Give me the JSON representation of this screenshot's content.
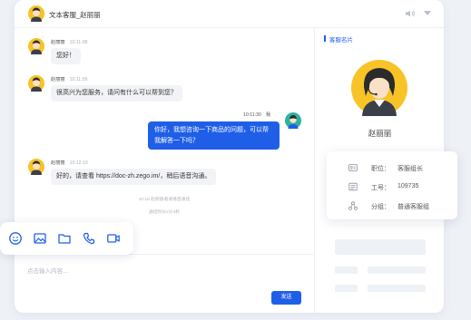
{
  "header": {
    "title": "文本客服_赵丽丽"
  },
  "messages": [
    {
      "name": "赵丽丽",
      "time": "10:11:08",
      "text": "您好！"
    },
    {
      "name": "赵丽丽",
      "time": "10:11:09",
      "text": "很高兴为您服务，请问有什么可以帮到您？"
    },
    {
      "name": "我",
      "time": "10:11:30",
      "text": "你好，我想咨询一下商品的问题，可以帮我解答一下吗？"
    },
    {
      "name": "赵丽丽",
      "time": "10:12:10",
      "text": "好的，请查看 https://doc-zh.zego.im/，稍后语音沟通。"
    }
  ],
  "system": {
    "line1": "10:18 赵丽丽邀请语音通话",
    "line2": "通话时长2分3秒"
  },
  "toolbar": {
    "icons": [
      "emoji-icon",
      "image-icon",
      "folder-icon",
      "phone-icon",
      "video-icon"
    ]
  },
  "input": {
    "placeholder": "点击输入内容..."
  },
  "send_label": "发送",
  "panel": {
    "title": "客服名片",
    "agent_name": "赵丽丽"
  },
  "card": {
    "rows": [
      {
        "icon": "id-card-icon",
        "label": "职位：",
        "value": "客服组长"
      },
      {
        "icon": "badge-icon",
        "label": "工号：",
        "value": "109735"
      },
      {
        "icon": "group-icon",
        "label": "分组：",
        "value": "普通客服组"
      }
    ]
  },
  "colors": {
    "accent": "#1f5fe8",
    "bubble_other": "#f1f3f6",
    "avatar_bg": "#f7c326"
  }
}
